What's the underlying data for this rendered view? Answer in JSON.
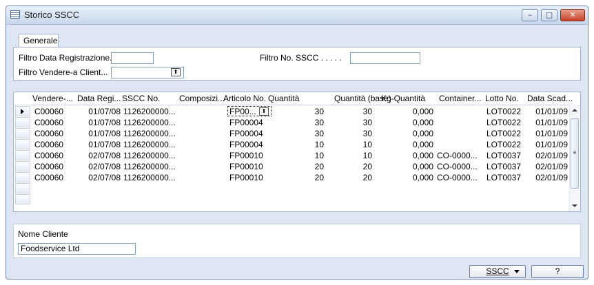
{
  "window": {
    "title": "Storico SSCC",
    "minimize": "–",
    "maximize": "□",
    "close": "✕"
  },
  "tabs": [
    {
      "label": "Generale"
    }
  ],
  "filters": {
    "data_registrazione_label": "Filtro Data Registrazione.",
    "data_registrazione_value": "",
    "no_sscc_label": "Filtro No. SSCC . . . . .",
    "no_sscc_value": "",
    "vendere_label": "Filtro Vendere-a Client...",
    "vendere_value": "",
    "lookup_glyph": "⬆"
  },
  "table": {
    "columns": [
      "Vendere-...",
      "Data Regi...",
      "SSCC No.",
      "Composizi...",
      "Articolo No.",
      "Quantità",
      "Quantità (base)",
      "Kg-Quantità",
      "Container...",
      "Lotto No.",
      "Data Scad..."
    ],
    "rows": [
      {
        "vendere": "C00060",
        "data": "01/07/08",
        "sscc": "1126200000...",
        "comp": "",
        "articolo": "FP00...",
        "quantita": "30",
        "base": "30",
        "kg": "0,000",
        "container": "",
        "lotto": "LOT0022",
        "scad": "01/01/09"
      },
      {
        "vendere": "C00060",
        "data": "01/07/08",
        "sscc": "1126200000...",
        "comp": "",
        "articolo": "FP00004",
        "quantita": "30",
        "base": "30",
        "kg": "0,000",
        "container": "",
        "lotto": "LOT0022",
        "scad": "01/01/09"
      },
      {
        "vendere": "C00060",
        "data": "01/07/08",
        "sscc": "1126200000...",
        "comp": "",
        "articolo": "FP00004",
        "quantita": "30",
        "base": "30",
        "kg": "0,000",
        "container": "",
        "lotto": "LOT0022",
        "scad": "01/01/09"
      },
      {
        "vendere": "C00060",
        "data": "01/07/08",
        "sscc": "1126200000...",
        "comp": "",
        "articolo": "FP00004",
        "quantita": "10",
        "base": "10",
        "kg": "0,000",
        "container": "",
        "lotto": "LOT0022",
        "scad": "01/01/09"
      },
      {
        "vendere": "C00060",
        "data": "02/07/08",
        "sscc": "1126200000...",
        "comp": "",
        "articolo": "FP00010",
        "quantita": "10",
        "base": "10",
        "kg": "0,000",
        "container": "CO-0000...",
        "lotto": "LOT0037",
        "scad": "02/01/09"
      },
      {
        "vendere": "C00060",
        "data": "02/07/08",
        "sscc": "1126200000...",
        "comp": "",
        "articolo": "FP00010",
        "quantita": "20",
        "base": "20",
        "kg": "0,000",
        "container": "CO-0000...",
        "lotto": "LOT0037",
        "scad": "02/01/09"
      },
      {
        "vendere": "C00060",
        "data": "02/07/08",
        "sscc": "1126200000...",
        "comp": "",
        "articolo": "FP00010",
        "quantita": "20",
        "base": "20",
        "kg": "0,000",
        "container": "CO-0000...",
        "lotto": "LOT0037",
        "scad": "02/01/09"
      }
    ]
  },
  "nome_cliente": {
    "label": "Nome Cliente",
    "value": "Foodservice Ltd"
  },
  "buttons": {
    "sscc": "SSCC",
    "help": "?"
  },
  "icons": {
    "window": "form-icon",
    "lookup": "lookup-arrow-icon",
    "row_pointer": "current-row-arrow-icon"
  }
}
